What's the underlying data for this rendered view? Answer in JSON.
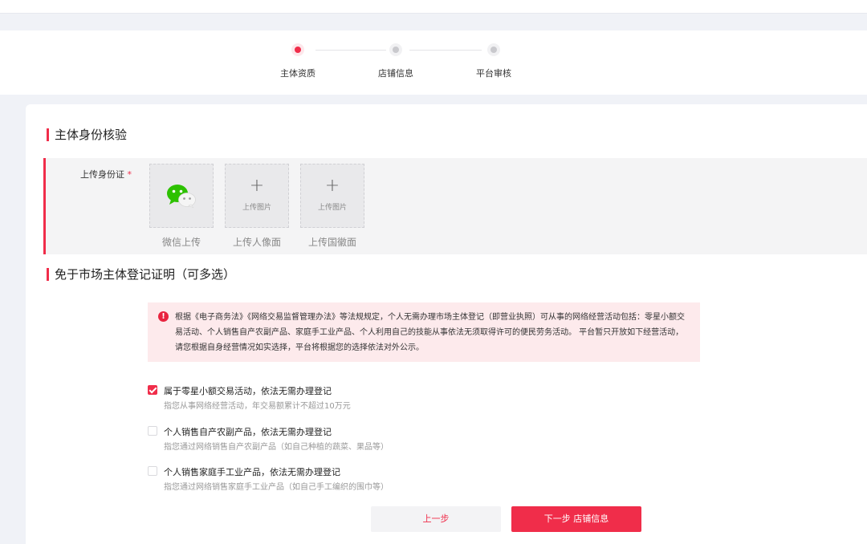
{
  "steps": [
    {
      "label": "主体资质",
      "state": "active"
    },
    {
      "label": "店铺信息",
      "state": "pending"
    },
    {
      "label": "平台审核",
      "state": "pending"
    }
  ],
  "identity": {
    "section_title": "主体身份核验",
    "upload_label": "上传身份证",
    "required_mark": "*",
    "tiles": [
      {
        "icon": "wechat-icon",
        "caption": "微信上传"
      },
      {
        "icon": "plus-icon",
        "hint": "上传图片",
        "caption": "上传人像面"
      },
      {
        "icon": "plus-icon",
        "hint": "上传图片",
        "caption": "上传国徽面"
      }
    ]
  },
  "exempt": {
    "section_title": "免于市场主体登记证明（可多选）",
    "notice": "根据《电子商务法》《网络交易监督管理办法》等法规规定，个人无需办理市场主体登记（即营业执照）可从事的网络经营活动包括：零星小额交易活动、个人销售自产农副产品、家庭手工业产品、个人利用自己的技能从事依法无须取得许可的便民劳务活动。 平台暂只开放如下经营活动，请您根据自身经营情况如实选择，平台将根据您的选择依法对外公示。",
    "options": [
      {
        "title": "属于零星小额交易活动，依法无需办理登记",
        "desc": "指您从事网络经营活动，年交易额累计不超过10万元",
        "checked": true
      },
      {
        "title": "个人销售自产农副产品，依法无需办理登记",
        "desc": "指您通过网络销售自产农副产品（如自己种植的蔬菜、果品等）",
        "checked": false
      },
      {
        "title": "个人销售家庭手工业产品，依法无需办理登记",
        "desc": "指您通过网络销售家庭手工业产品（如自己手工编织的围巾等）",
        "checked": false
      }
    ]
  },
  "actions": {
    "prev_label": "上一步",
    "next_label": "下一步 店铺信息"
  },
  "colors": {
    "accent": "#f02d4a",
    "wechat_green": "#2dc100",
    "notice_bg": "#fdeaec"
  }
}
